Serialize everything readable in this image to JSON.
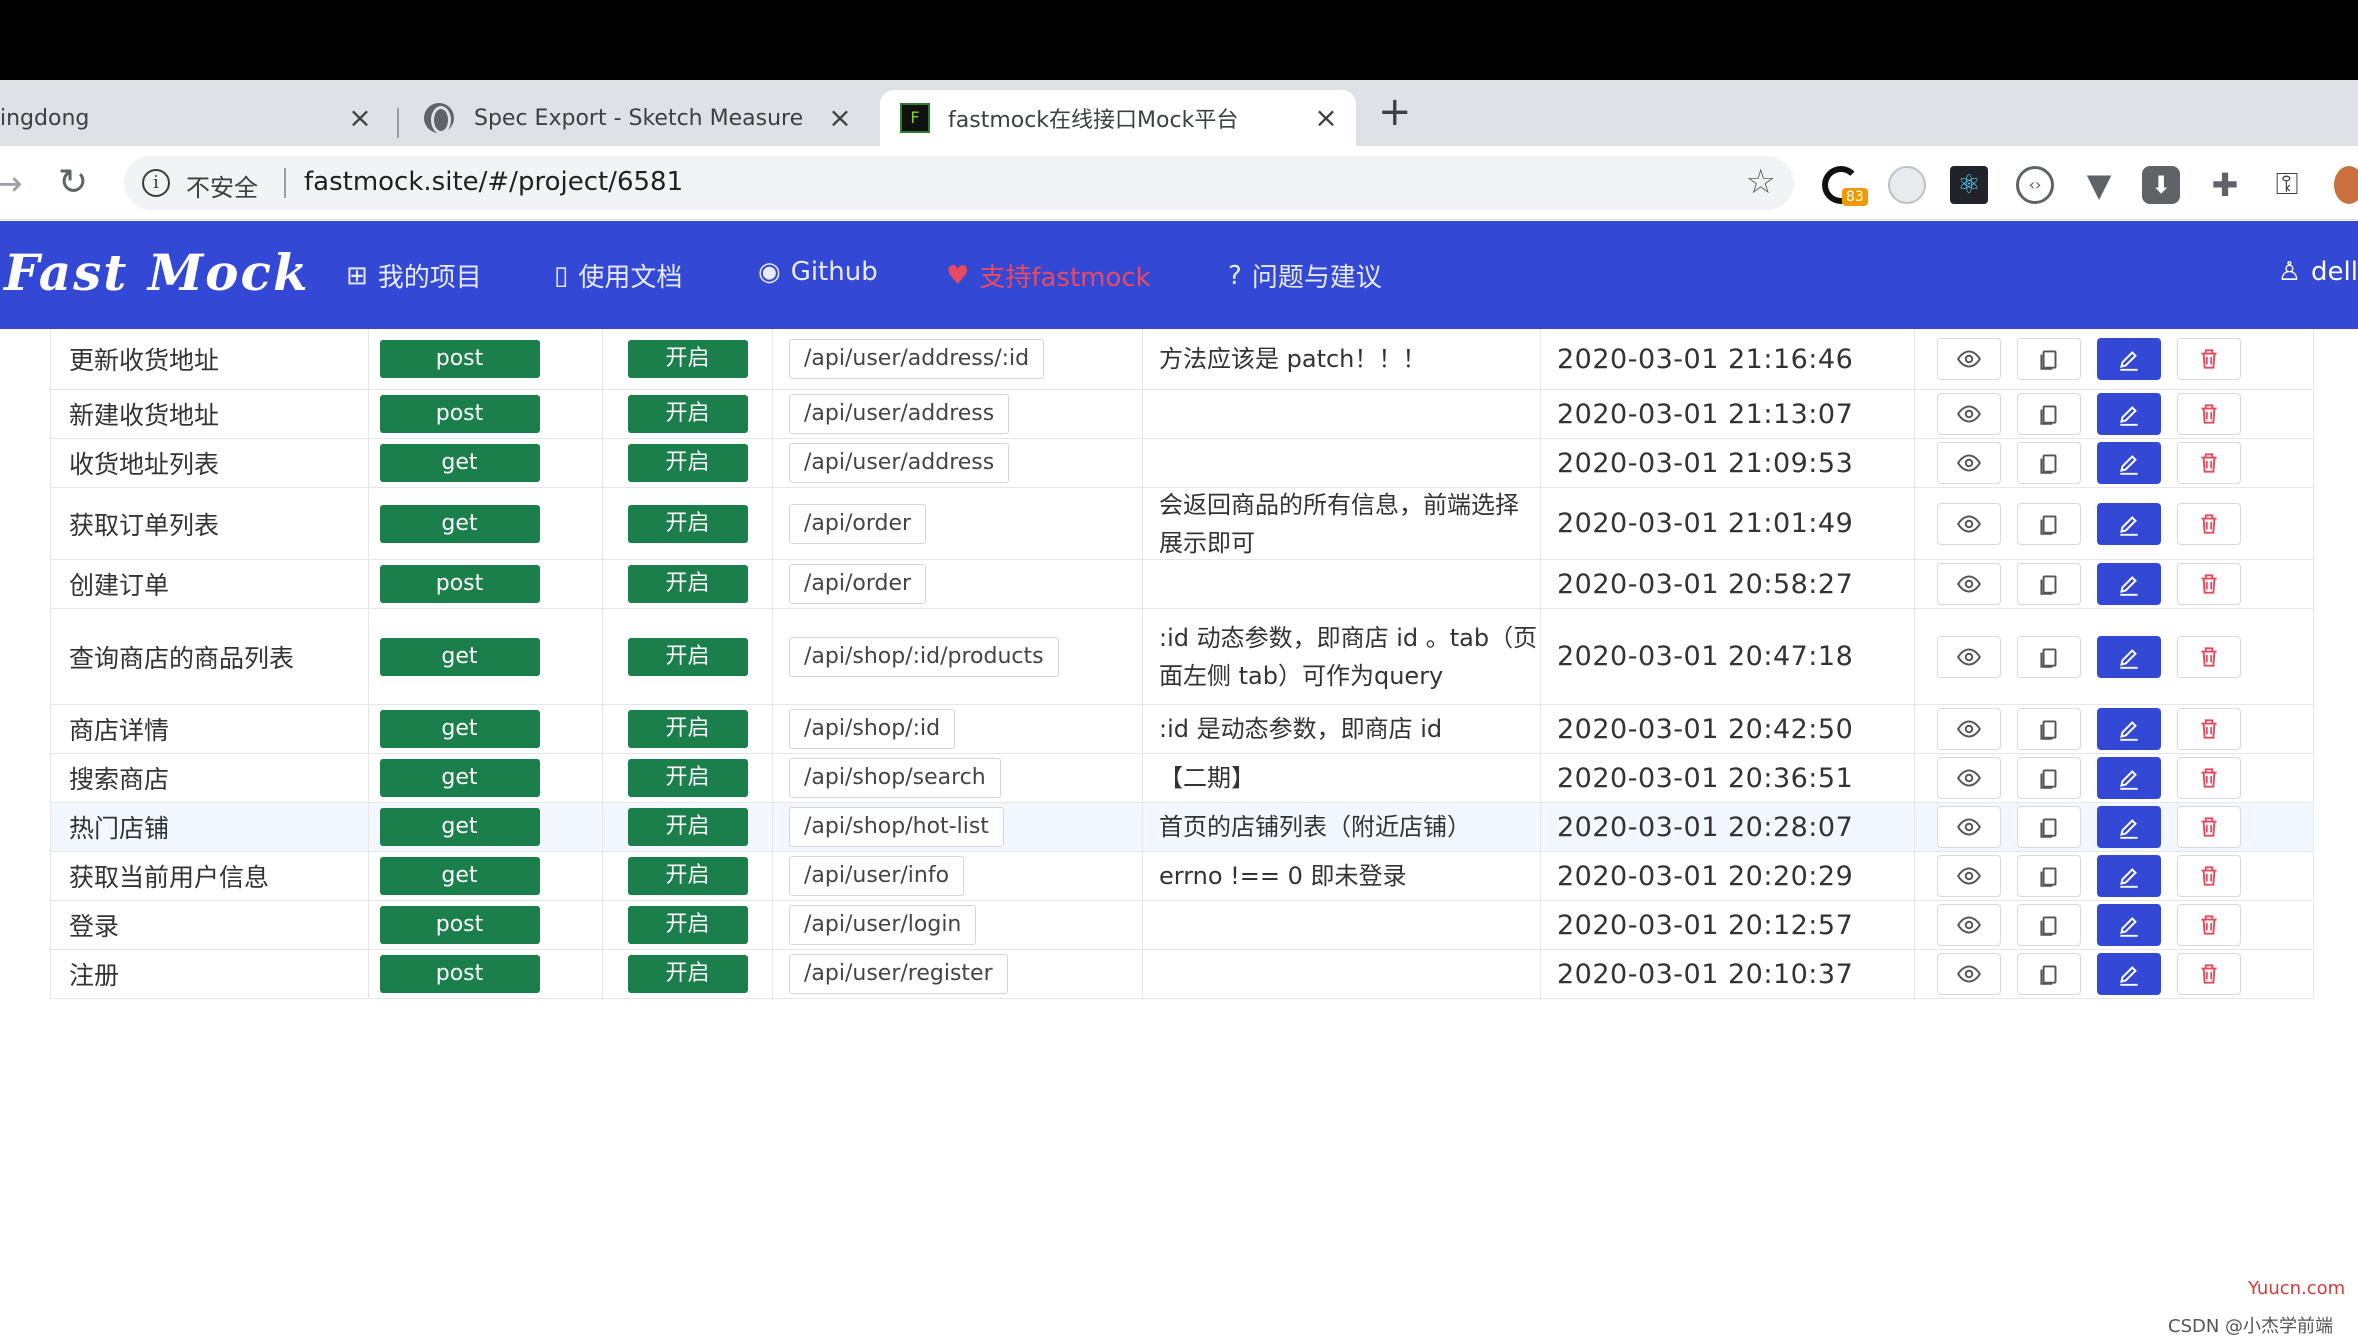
{
  "browser": {
    "tabs": [
      {
        "title": "ingdong",
        "close": "×"
      },
      {
        "title": "Spec Export - Sketch Measure",
        "close": "×"
      },
      {
        "title": "fastmock在线接口Mock平台",
        "close": "×"
      }
    ],
    "new_tab": "+",
    "security_label": "不安全",
    "url": "fastmock.site/#/project/6581",
    "extension_badge": "83"
  },
  "app": {
    "brand": "Fast Mock",
    "nav": [
      {
        "icon": "grid-icon",
        "label": "我的项目"
      },
      {
        "icon": "book-icon",
        "label": "使用文档"
      },
      {
        "icon": "github-icon",
        "label": "Github"
      },
      {
        "icon": "heart-icon",
        "label": "支持fastmock"
      },
      {
        "icon": "question-icon",
        "label": "问题与建议"
      }
    ],
    "user": "dell"
  },
  "table": {
    "rows": [
      {
        "name": "更新收货地址",
        "method": "post",
        "status": "开启",
        "path": "/api/user/address/:id",
        "desc": "方法应该是 patch！！！",
        "time": "2020-03-01 21:16:46"
      },
      {
        "name": "新建收货地址",
        "method": "post",
        "status": "开启",
        "path": "/api/user/address",
        "desc": "",
        "time": "2020-03-01 21:13:07"
      },
      {
        "name": "收货地址列表",
        "method": "get",
        "status": "开启",
        "path": "/api/user/address",
        "desc": "",
        "time": "2020-03-01 21:09:53"
      },
      {
        "name": "获取订单列表",
        "method": "get",
        "status": "开启",
        "path": "/api/order",
        "desc": "会返回商品的所有信息，前端选择展示即可",
        "time": "2020-03-01 21:01:49"
      },
      {
        "name": "创建订单",
        "method": "post",
        "status": "开启",
        "path": "/api/order",
        "desc": "",
        "time": "2020-03-01 20:58:27"
      },
      {
        "name": "查询商店的商品列表",
        "method": "get",
        "status": "开启",
        "path": "/api/shop/:id/products",
        "desc": ":id 动态参数，即商店 id 。tab（页面左侧 tab）可作为query",
        "time": "2020-03-01 20:47:18"
      },
      {
        "name": "商店详情",
        "method": "get",
        "status": "开启",
        "path": "/api/shop/:id",
        "desc": ":id 是动态参数，即商店 id",
        "time": "2020-03-01 20:42:50"
      },
      {
        "name": "搜索商店",
        "method": "get",
        "status": "开启",
        "path": "/api/shop/search",
        "desc": "【二期】",
        "time": "2020-03-01 20:36:51"
      },
      {
        "name": "热门店铺",
        "method": "get",
        "status": "开启",
        "path": "/api/shop/hot-list",
        "desc": "首页的店铺列表（附近店铺）",
        "time": "2020-03-01 20:28:07"
      },
      {
        "name": "获取当前用户信息",
        "method": "get",
        "status": "开启",
        "path": "/api/user/info",
        "desc": "errno !== 0 即未登录",
        "time": "2020-03-01 20:20:29"
      },
      {
        "name": "登录",
        "method": "post",
        "status": "开启",
        "path": "/api/user/login",
        "desc": "",
        "time": "2020-03-01 20:12:57"
      },
      {
        "name": "注册",
        "method": "post",
        "status": "开启",
        "path": "/api/user/register",
        "desc": "",
        "time": "2020-03-01 20:10:37"
      }
    ],
    "highlighted_row": 8
  },
  "colors": {
    "nav_bg": "#3448d6",
    "tag_green": "#1a7f4a",
    "delete_red": "#e84a5f"
  },
  "watermarks": {
    "site": "Yuucn.com",
    "credit": "CSDN @小杰学前端"
  }
}
